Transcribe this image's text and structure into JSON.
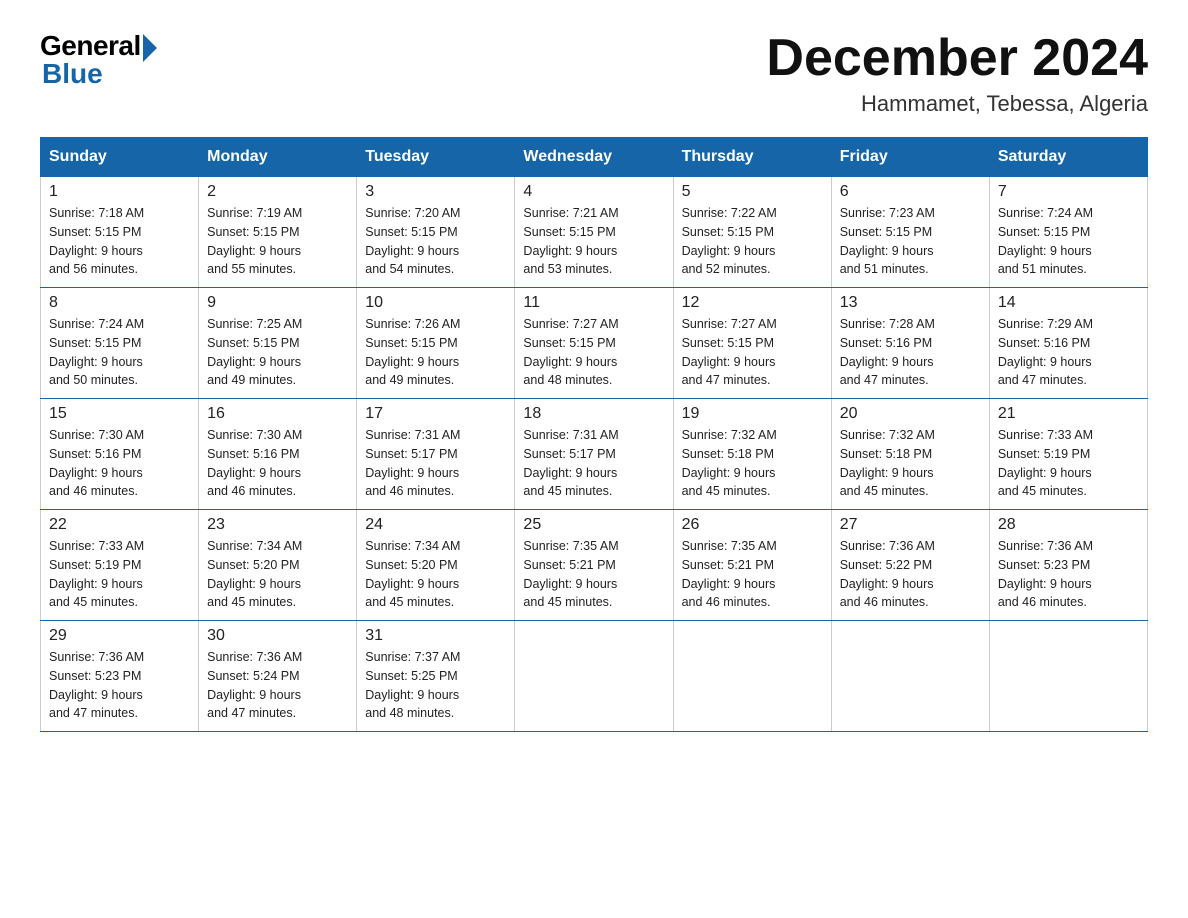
{
  "header": {
    "logo_general": "General",
    "logo_blue": "Blue",
    "month_year": "December 2024",
    "location": "Hammamet, Tebessa, Algeria"
  },
  "days_of_week": [
    "Sunday",
    "Monday",
    "Tuesday",
    "Wednesday",
    "Thursday",
    "Friday",
    "Saturday"
  ],
  "weeks": [
    [
      {
        "day": "1",
        "sunrise": "7:18 AM",
        "sunset": "5:15 PM",
        "daylight": "9 hours and 56 minutes."
      },
      {
        "day": "2",
        "sunrise": "7:19 AM",
        "sunset": "5:15 PM",
        "daylight": "9 hours and 55 minutes."
      },
      {
        "day": "3",
        "sunrise": "7:20 AM",
        "sunset": "5:15 PM",
        "daylight": "9 hours and 54 minutes."
      },
      {
        "day": "4",
        "sunrise": "7:21 AM",
        "sunset": "5:15 PM",
        "daylight": "9 hours and 53 minutes."
      },
      {
        "day": "5",
        "sunrise": "7:22 AM",
        "sunset": "5:15 PM",
        "daylight": "9 hours and 52 minutes."
      },
      {
        "day": "6",
        "sunrise": "7:23 AM",
        "sunset": "5:15 PM",
        "daylight": "9 hours and 51 minutes."
      },
      {
        "day": "7",
        "sunrise": "7:24 AM",
        "sunset": "5:15 PM",
        "daylight": "9 hours and 51 minutes."
      }
    ],
    [
      {
        "day": "8",
        "sunrise": "7:24 AM",
        "sunset": "5:15 PM",
        "daylight": "9 hours and 50 minutes."
      },
      {
        "day": "9",
        "sunrise": "7:25 AM",
        "sunset": "5:15 PM",
        "daylight": "9 hours and 49 minutes."
      },
      {
        "day": "10",
        "sunrise": "7:26 AM",
        "sunset": "5:15 PM",
        "daylight": "9 hours and 49 minutes."
      },
      {
        "day": "11",
        "sunrise": "7:27 AM",
        "sunset": "5:15 PM",
        "daylight": "9 hours and 48 minutes."
      },
      {
        "day": "12",
        "sunrise": "7:27 AM",
        "sunset": "5:15 PM",
        "daylight": "9 hours and 47 minutes."
      },
      {
        "day": "13",
        "sunrise": "7:28 AM",
        "sunset": "5:16 PM",
        "daylight": "9 hours and 47 minutes."
      },
      {
        "day": "14",
        "sunrise": "7:29 AM",
        "sunset": "5:16 PM",
        "daylight": "9 hours and 47 minutes."
      }
    ],
    [
      {
        "day": "15",
        "sunrise": "7:30 AM",
        "sunset": "5:16 PM",
        "daylight": "9 hours and 46 minutes."
      },
      {
        "day": "16",
        "sunrise": "7:30 AM",
        "sunset": "5:16 PM",
        "daylight": "9 hours and 46 minutes."
      },
      {
        "day": "17",
        "sunrise": "7:31 AM",
        "sunset": "5:17 PM",
        "daylight": "9 hours and 46 minutes."
      },
      {
        "day": "18",
        "sunrise": "7:31 AM",
        "sunset": "5:17 PM",
        "daylight": "9 hours and 45 minutes."
      },
      {
        "day": "19",
        "sunrise": "7:32 AM",
        "sunset": "5:18 PM",
        "daylight": "9 hours and 45 minutes."
      },
      {
        "day": "20",
        "sunrise": "7:32 AM",
        "sunset": "5:18 PM",
        "daylight": "9 hours and 45 minutes."
      },
      {
        "day": "21",
        "sunrise": "7:33 AM",
        "sunset": "5:19 PM",
        "daylight": "9 hours and 45 minutes."
      }
    ],
    [
      {
        "day": "22",
        "sunrise": "7:33 AM",
        "sunset": "5:19 PM",
        "daylight": "9 hours and 45 minutes."
      },
      {
        "day": "23",
        "sunrise": "7:34 AM",
        "sunset": "5:20 PM",
        "daylight": "9 hours and 45 minutes."
      },
      {
        "day": "24",
        "sunrise": "7:34 AM",
        "sunset": "5:20 PM",
        "daylight": "9 hours and 45 minutes."
      },
      {
        "day": "25",
        "sunrise": "7:35 AM",
        "sunset": "5:21 PM",
        "daylight": "9 hours and 45 minutes."
      },
      {
        "day": "26",
        "sunrise": "7:35 AM",
        "sunset": "5:21 PM",
        "daylight": "9 hours and 46 minutes."
      },
      {
        "day": "27",
        "sunrise": "7:36 AM",
        "sunset": "5:22 PM",
        "daylight": "9 hours and 46 minutes."
      },
      {
        "day": "28",
        "sunrise": "7:36 AM",
        "sunset": "5:23 PM",
        "daylight": "9 hours and 46 minutes."
      }
    ],
    [
      {
        "day": "29",
        "sunrise": "7:36 AM",
        "sunset": "5:23 PM",
        "daylight": "9 hours and 47 minutes."
      },
      {
        "day": "30",
        "sunrise": "7:36 AM",
        "sunset": "5:24 PM",
        "daylight": "9 hours and 47 minutes."
      },
      {
        "day": "31",
        "sunrise": "7:37 AM",
        "sunset": "5:25 PM",
        "daylight": "9 hours and 48 minutes."
      },
      null,
      null,
      null,
      null
    ]
  ],
  "labels": {
    "sunrise": "Sunrise:",
    "sunset": "Sunset:",
    "daylight": "Daylight:"
  }
}
